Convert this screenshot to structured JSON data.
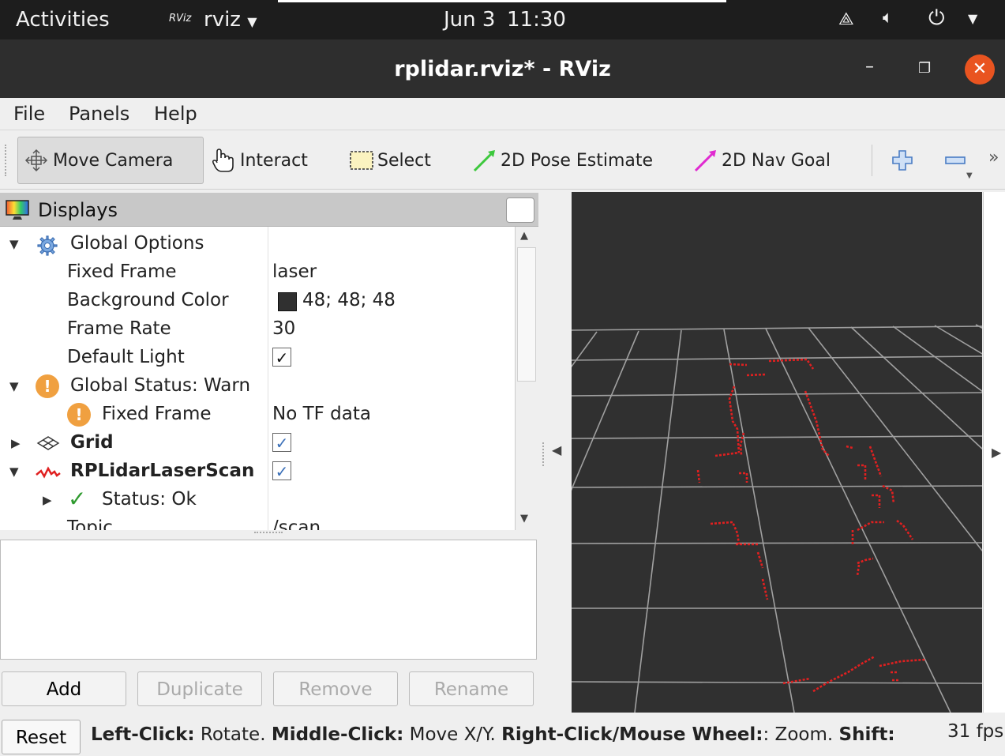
{
  "topbar": {
    "activities": "Activities",
    "app_badge": "RViz",
    "app_name": "rviz",
    "date": "Jun 3",
    "time": "11:30"
  },
  "window": {
    "title": "rplidar.rviz* - RViz",
    "close_glyph": "✕",
    "minimize_glyph": "–",
    "maximize_glyph": "❐"
  },
  "menu": {
    "file": "File",
    "panels": "Panels",
    "help": "Help"
  },
  "toolbar": {
    "move_camera": "Move Camera",
    "interact": "Interact",
    "select": "Select",
    "pose_estimate": "2D Pose Estimate",
    "nav_goal": "2D Nav Goal",
    "overflow": "»"
  },
  "displays": {
    "header": "Displays",
    "rows": {
      "global_options": "Global Options",
      "fixed_frame": {
        "label": "Fixed Frame",
        "value": "laser"
      },
      "background_color": {
        "label": "Background Color",
        "value": "48; 48; 48",
        "swatch": "#303030"
      },
      "frame_rate": {
        "label": "Frame Rate",
        "value": "30"
      },
      "default_light": {
        "label": "Default Light",
        "checked": true
      },
      "global_status": "Global Status: Warn",
      "fixed_frame_warn": {
        "label": "Fixed Frame",
        "value": "No TF data"
      },
      "grid": {
        "label": "Grid",
        "checked": true
      },
      "laser_scan": {
        "label": "RPLidarLaserScan",
        "checked": true
      },
      "status_ok": "Status: Ok",
      "topic": {
        "label": "Topic",
        "value": "/scan"
      }
    },
    "check_glyph": "✓",
    "buttons": {
      "add": "Add",
      "duplicate": "Duplicate",
      "remove": "Remove",
      "rename": "Rename"
    }
  },
  "statusbar": {
    "reset": "Reset",
    "left_click_key": "Left-Click:",
    "left_click_action": " Rotate. ",
    "middle_click_key": "Middle-Click:",
    "middle_click_action": " Move X/Y. ",
    "right_click_key": "Right-Click/Mouse Wheel:",
    "right_click_action": ": Zoom. ",
    "shift_key": "Shift:",
    "fps": "31 fps"
  },
  "colors": {
    "accent_close": "#e95420",
    "warn": "#c08a2e",
    "link_blue": "#3a6fb8",
    "scan_red": "#e02020",
    "view_bg": "#303030"
  }
}
